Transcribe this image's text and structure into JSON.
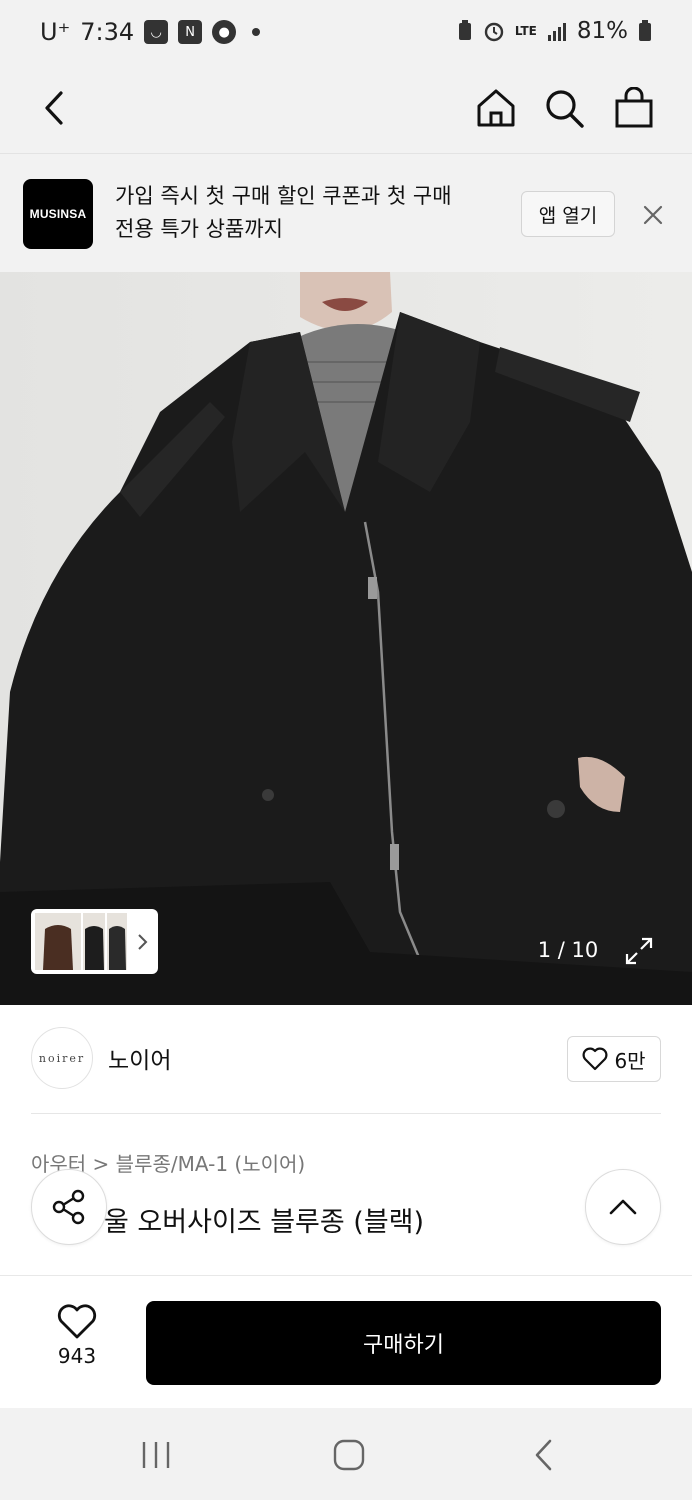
{
  "status_bar": {
    "carrier": "U⁺",
    "time": "7:34",
    "network": "LTE",
    "battery": "81%"
  },
  "header": {
    "back_icon": "chevron-left-icon",
    "home_icon": "home-icon",
    "search_icon": "search-icon",
    "cart_icon": "shopping-bag-icon"
  },
  "promo": {
    "logo_text": "MUSINSA",
    "line1": "가입 즉시 첫 구매 할인 쿠폰과 첫 구매",
    "line2": "전용 특가 상품까지",
    "open_label": "앱 열기"
  },
  "gallery": {
    "counter": "1 / 10"
  },
  "brand": {
    "logo_text": "noirer",
    "name": "노이어",
    "likes": "6만"
  },
  "product": {
    "breadcrumb": "아우터 > 블루종/MA-1 (노이어)",
    "title_visible": "울 오버사이즈 블루종 (블랙)"
  },
  "buy_bar": {
    "wish_count": "943",
    "buy_label": "구매하기"
  },
  "colors": {
    "background": "#f2f2f2",
    "primary_button": "#000000",
    "muted_text": "#777777"
  }
}
